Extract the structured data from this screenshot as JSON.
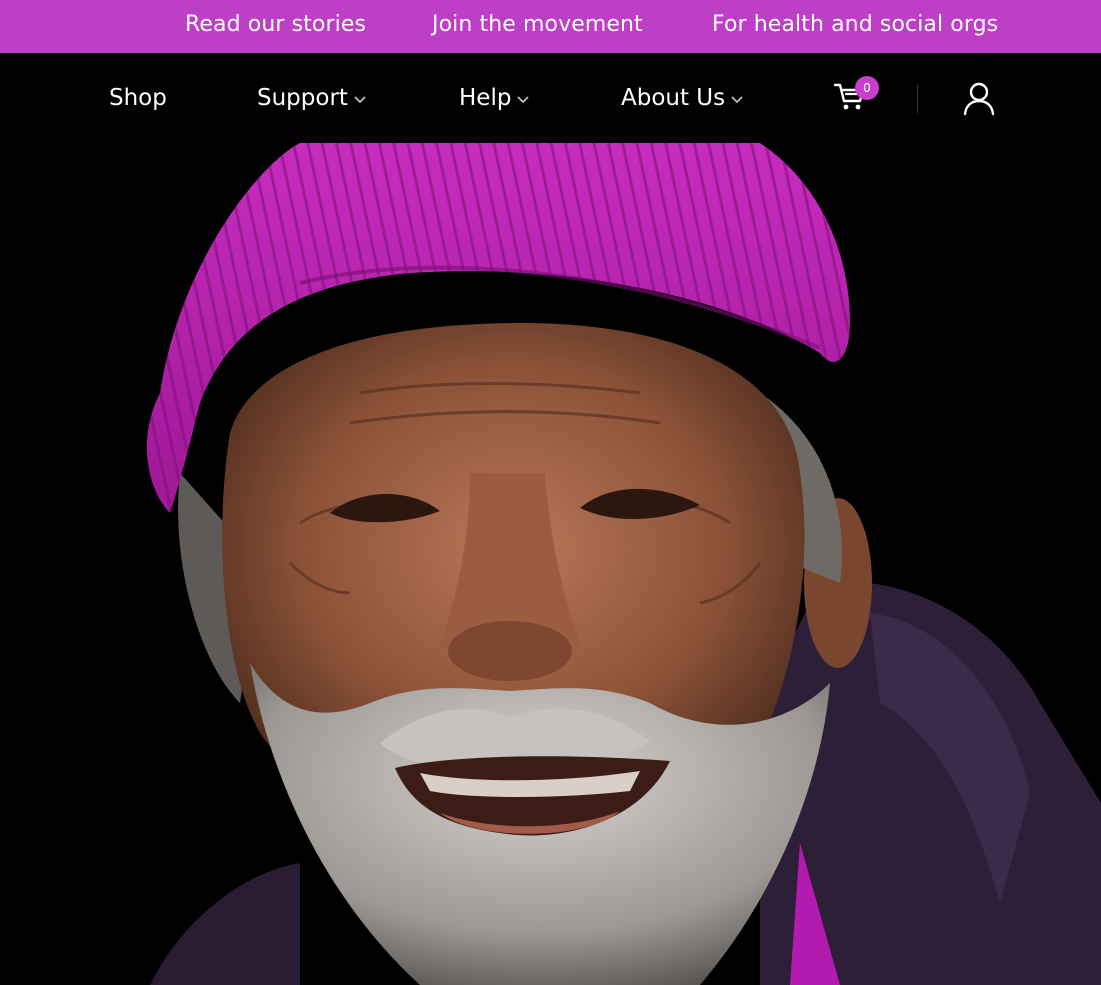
{
  "topbar": {
    "links": [
      {
        "label": "Read our stories"
      },
      {
        "label": "Join the movement"
      },
      {
        "label": "For health and social orgs"
      }
    ],
    "bg_color": "#bd3fc6"
  },
  "nav": {
    "items": [
      {
        "label": "Shop",
        "has_dropdown": false
      },
      {
        "label": "Support",
        "has_dropdown": true
      },
      {
        "label": "Help",
        "has_dropdown": true
      },
      {
        "label": "About Us",
        "has_dropdown": true
      }
    ],
    "cart": {
      "icon": "cart-icon",
      "count": "0"
    },
    "account": {
      "icon": "user-icon"
    }
  },
  "hero": {
    "image": "smiling-bearded-man-in-magenta-beanie-photo"
  },
  "colors": {
    "accent": "#bd3fc6",
    "badge": "#c93fc9",
    "nav_bg": "#000000",
    "text": "#ffffff"
  }
}
